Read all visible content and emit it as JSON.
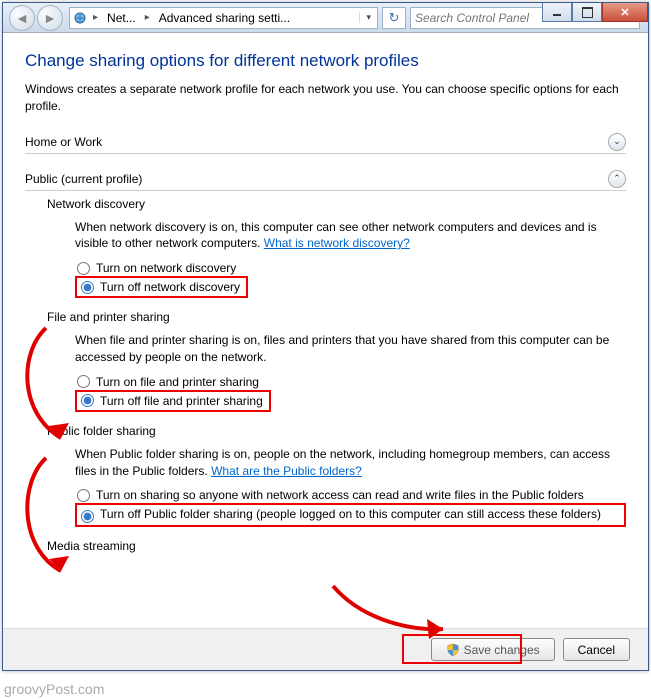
{
  "breadcrumb": {
    "seg1": "Net...",
    "seg2": "Advanced sharing setti..."
  },
  "search": {
    "placeholder": "Search Control Panel"
  },
  "page": {
    "title": "Change sharing options for different network profiles",
    "intro": "Windows creates a separate network profile for each network you use. You can choose specific options for each profile."
  },
  "profiles": {
    "home": {
      "label": "Home or Work"
    },
    "public": {
      "label": "Public (current profile)"
    }
  },
  "sections": {
    "discovery": {
      "title": "Network discovery",
      "desc": "When network discovery is on, this computer can see other network computers and devices and is visible to other network computers. ",
      "help": "What is network discovery?",
      "on": "Turn on network discovery",
      "off": "Turn off network discovery"
    },
    "fileprint": {
      "title": "File and printer sharing",
      "desc": "When file and printer sharing is on, files and printers that you have shared from this computer can be accessed by people on the network.",
      "on": "Turn on file and printer sharing",
      "off": "Turn off file and printer sharing"
    },
    "publicfolder": {
      "title": "Public folder sharing",
      "desc": "When Public folder sharing is on, people on the network, including homegroup members, can access files in the Public folders. ",
      "help": "What are the Public folders?",
      "on": "Turn on sharing so anyone with network access can read and write files in the Public folders",
      "off": "Turn off Public folder sharing (people logged on to this computer can still access these folders)"
    },
    "media": {
      "title": "Media streaming"
    }
  },
  "buttons": {
    "save": "Save changes",
    "cancel": "Cancel"
  },
  "watermark": "groovyPost.com"
}
